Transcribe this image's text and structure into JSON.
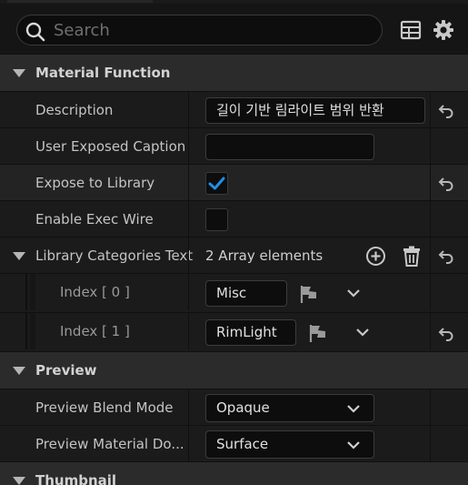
{
  "search": {
    "placeholder": "Search"
  },
  "toolbar": {
    "table_icon": "table-view-icon",
    "settings_icon": "gear-icon"
  },
  "material_function": {
    "title": "Material Function",
    "description_label": "Description",
    "description_value": "길이 기반 림라이트 범위 반환",
    "user_exposed_caption_label": "User Exposed Caption",
    "user_exposed_caption_value": "",
    "expose_to_library_label": "Expose to Library",
    "expose_to_library_checked": true,
    "enable_exec_wire_label": "Enable Exec Wire",
    "enable_exec_wire_checked": false,
    "library_categories_label": "Library Categories Text",
    "library_categories_count": "2 Array elements",
    "elements": [
      {
        "index_label": "Index [ 0 ]",
        "value": "Misc"
      },
      {
        "index_label": "Index [ 1 ]",
        "value": "RimLight"
      }
    ]
  },
  "preview": {
    "title": "Preview",
    "blend_mode_label": "Preview Blend Mode",
    "blend_mode_value": "Opaque",
    "material_domain_label": "Preview Material Do...",
    "material_domain_value": "Surface"
  },
  "thumbnail": {
    "title": "Thumbnail"
  },
  "colors": {
    "accent": "#1f8fe8",
    "panel": "#1b1b1b",
    "category": "#2b2b2b",
    "field": "#0d0d0d"
  }
}
